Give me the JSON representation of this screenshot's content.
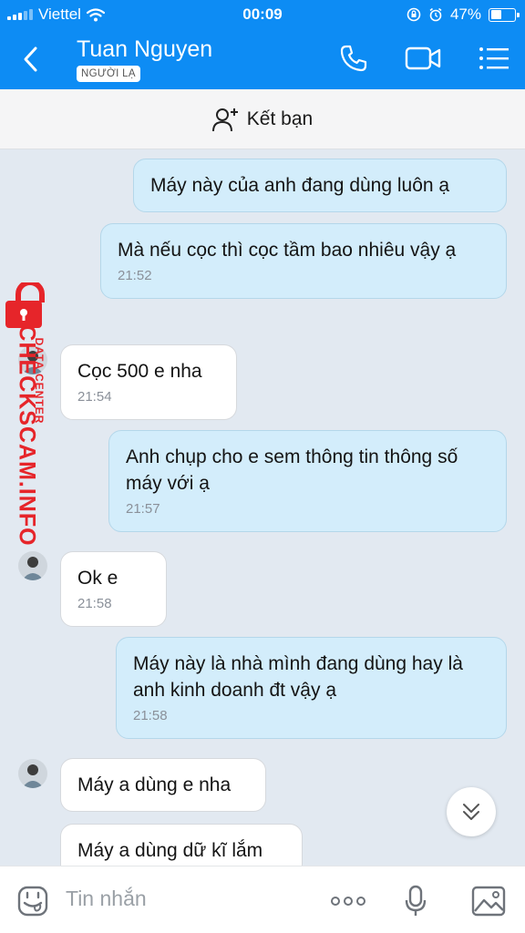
{
  "status_bar": {
    "carrier": "Viettel",
    "time": "00:09",
    "battery": "47%",
    "battery_level": 0.47
  },
  "header": {
    "contact_name": "Tuan Nguyen",
    "badge": "NGƯỜI LẠ",
    "back_icon": "chevron-left-icon",
    "call_icon": "phone-icon",
    "video_icon": "video-camera-icon",
    "menu_icon": "list-menu-icon",
    "color": "#0d8cf4"
  },
  "add_friend": {
    "label": "Kết bạn",
    "icon": "add-person-icon"
  },
  "messages": [
    {
      "direction": "out",
      "text": "Máy này của anh đang dùng luôn ạ",
      "time": ""
    },
    {
      "direction": "out",
      "text": "Mà nếu cọc thì cọc tầm bao nhiêu vậy ạ",
      "time": "21:52"
    },
    {
      "direction": "in",
      "text": "Cọc 500 e nha",
      "time": "21:54"
    },
    {
      "direction": "out",
      "text": "Anh chụp cho e sem thông tin thông số máy với ạ",
      "time": "21:57"
    },
    {
      "direction": "in",
      "text": "Ok e",
      "time": "21:58"
    },
    {
      "direction": "out",
      "text": "Máy này là nhà mình đang dùng hay là anh kinh doanh đt vậy ạ",
      "time": "21:58"
    },
    {
      "direction": "in",
      "text": "Máy a dùng e nha",
      "time": ""
    },
    {
      "direction": "in",
      "text": "Máy a dùng dữ kĩ lắm",
      "time": ""
    }
  ],
  "watermark": {
    "main": "CHECKSCAM.INFO",
    "sub": "DATA CENTER",
    "color": "#e6252a"
  },
  "input_bar": {
    "placeholder": "Tin nhắn",
    "emoji_icon": "sticker-emoji-icon",
    "more_icon": "more-dots-icon",
    "mic_icon": "microphone-icon",
    "image_icon": "image-gallery-icon"
  },
  "scroll_button_icon": "double-chevron-down-icon"
}
